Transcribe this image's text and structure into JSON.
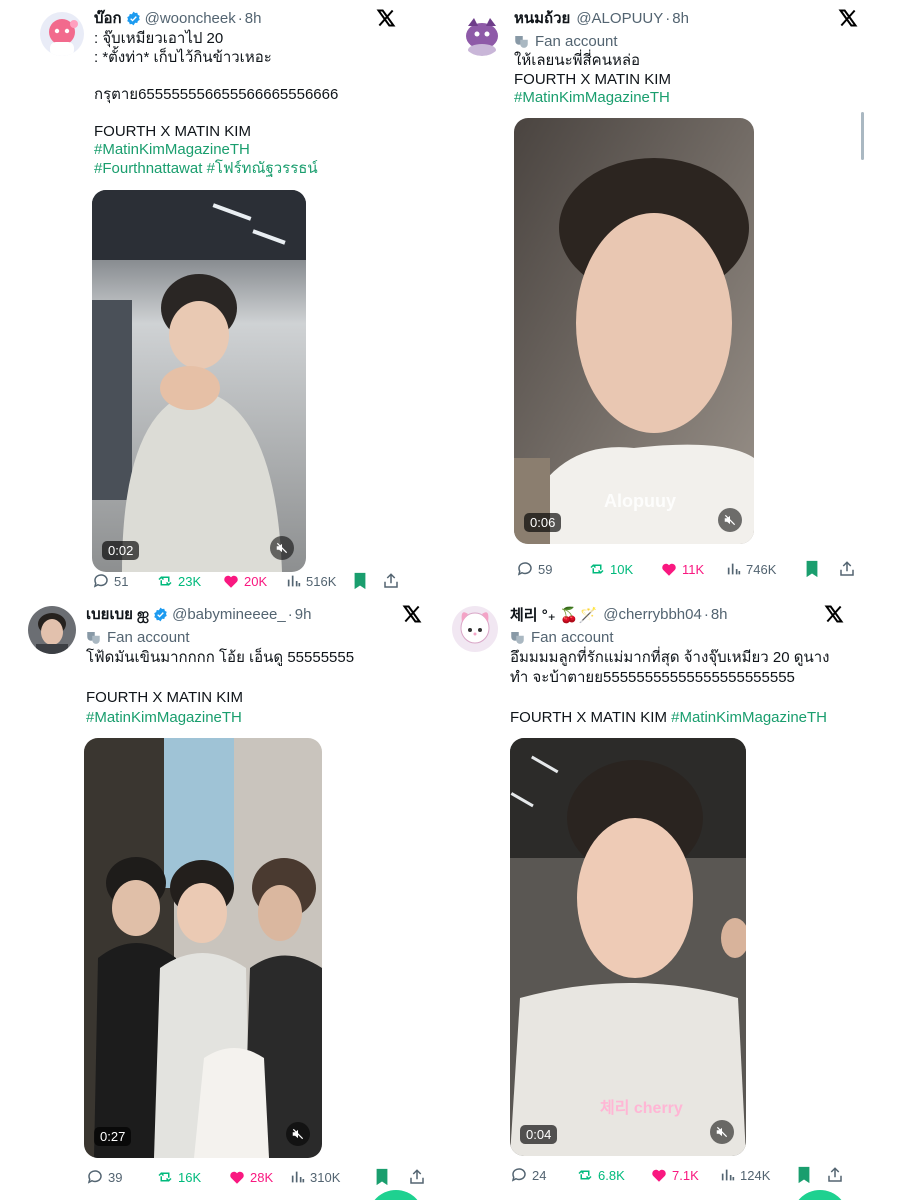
{
  "tweets": [
    {
      "name": "บ๊อก",
      "verified": true,
      "handle": "@wooncheek",
      "time": "8h",
      "fan_account": "",
      "lines": [
        ": จุ๊บเหมียวเอาไป 20",
        ": *ตั้งท่า* เก็บไว้กินข้าวเหอะ",
        "",
        "กรุตาย655555556655566665556666",
        "",
        "FOURTH X MATIN KIM"
      ],
      "tags": [
        "#MatinKimMagazineTH",
        "#Fourthnattawat #โฟร์ทณัฐวรรธน์"
      ],
      "video_duration": "0:02",
      "watermark": "",
      "replies": "51",
      "retweets": "23K",
      "likes": "20K",
      "views": "516K"
    },
    {
      "name": "หนมถ้วย",
      "verified": false,
      "handle": "@ALOPUUY",
      "time": "8h",
      "fan_account": "Fan account",
      "lines": [
        "ให้เลยนะพี่สี่คนหล่อ",
        "FOURTH X MATIN KIM"
      ],
      "tags": [
        "#MatinKimMagazineTH"
      ],
      "video_duration": "0:06",
      "watermark": "Alopuuy",
      "replies": "59",
      "retweets": "10K",
      "likes": "11K",
      "views": "746K"
    },
    {
      "name": "เบยเบย ஐ",
      "verified": true,
      "handle": "@babymineeee_",
      "time": "9h",
      "fan_account": "Fan account",
      "lines": [
        "โฟ้ดมันเขินมากกกก โอ้ย เอ็นดู 55555555",
        "",
        "FOURTH X MATIN KIM"
      ],
      "tags": [
        "#MatinKimMagazineTH"
      ],
      "video_duration": "0:27",
      "watermark": "",
      "replies": "39",
      "retweets": "16K",
      "likes": "28K",
      "views": "310K"
    },
    {
      "name": "체리 °₊ 🍒🪄",
      "verified": false,
      "handle": "@cherrybbh04",
      "time": "8h",
      "fan_account": "Fan account",
      "lines": [
        "อึมมมมลูกที่รักแม่มากที่สุด จ้างจุ๊บเหมียว 20 ดูนาง",
        "ทำ จะบ้าตายย55555555555555555555555",
        ""
      ],
      "inline_text": "FOURTH X MATIN KIM",
      "tags": [
        "#MatinKimMagazineTH"
      ],
      "video_duration": "0:04",
      "watermark": "체리 cherry",
      "replies": "24",
      "retweets": "6.8K",
      "likes": "7.1K",
      "views": "124K"
    }
  ],
  "colors": {
    "accent_green": "#1a9e6e",
    "retweet_green": "#00ba7c",
    "like_pink": "#f91880",
    "muted_gray": "#536471",
    "verified_blue": "#1d9bf0"
  },
  "icons": [
    "x-logo-icon",
    "verified-badge-icon",
    "fan-account-icon",
    "reply-icon",
    "retweet-icon",
    "like-icon",
    "views-icon",
    "bookmark-icon",
    "share-icon",
    "mute-icon"
  ]
}
